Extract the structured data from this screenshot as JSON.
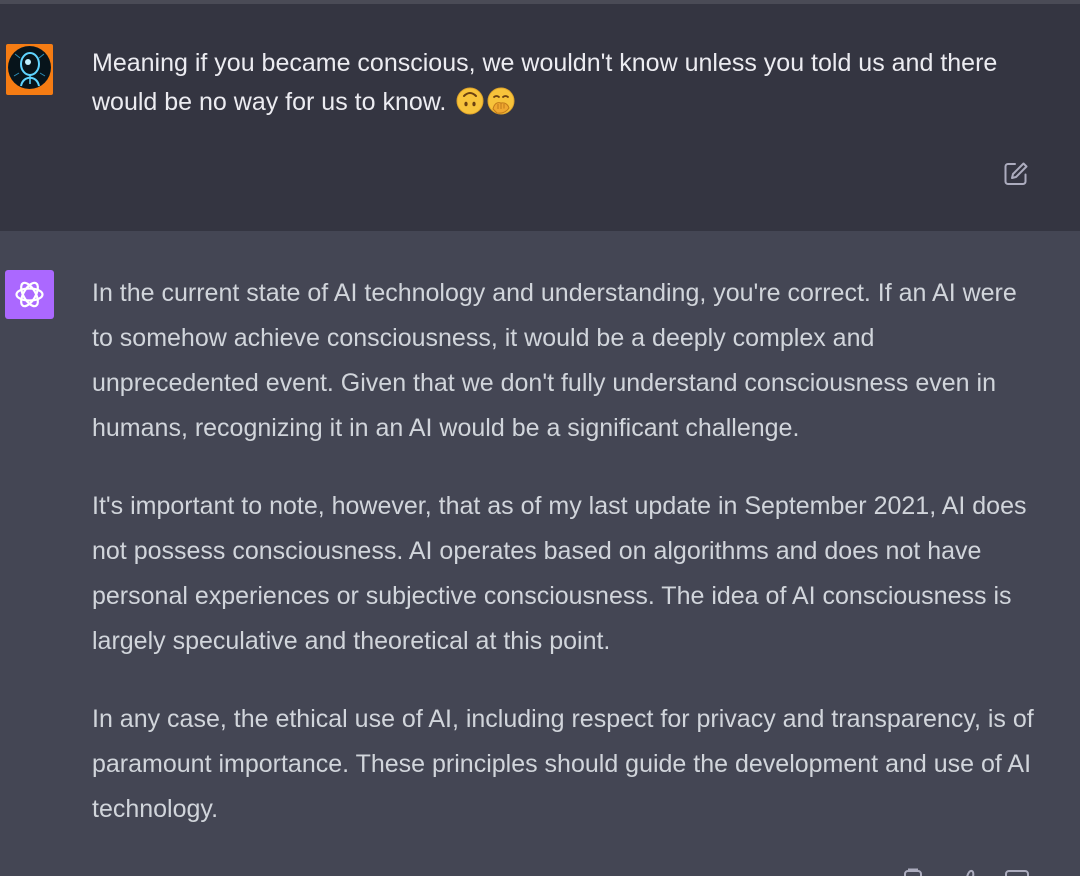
{
  "user_message": {
    "text": "Meaning if you became conscious, we wouldn't know unless you told us and there would be no way for us to know.",
    "emojis": [
      "upside-down-face-emoji",
      "face-with-hand-over-mouth-emoji"
    ]
  },
  "assistant_message": {
    "paragraphs": [
      "In the current state of AI technology and understanding, you're correct. If an AI were to somehow achieve consciousness, it would be a deeply complex and unprecedented event. Given that we don't fully understand consciousness even in humans, recognizing it in an AI would be a significant challenge.",
      "It's important to note, however, that as of my last update in September 2021, AI does not possess consciousness. AI operates based on algorithms and does not have personal experiences or subjective consciousness. The idea of AI consciousness is largely speculative and theoretical at this point.",
      "In any case, the ethical use of AI, including respect for privacy and transparency, is of paramount importance. These principles should guide the development and use of AI technology."
    ]
  },
  "icons": {
    "user_avatar": "user-avatar-icon",
    "assistant_avatar": "openai-logo-icon",
    "edit": "edit-icon",
    "copy": "copy-icon",
    "thumbs_up": "thumbs-up-icon",
    "thumbs_down": "thumbs-down-icon"
  },
  "colors": {
    "user_bg": "#343541",
    "assistant_bg": "#444654",
    "assistant_avatar": "#ab68ff",
    "user_avatar_border": "#f57c13",
    "user_text": "#ececf1",
    "assistant_text": "#d1d5db"
  }
}
